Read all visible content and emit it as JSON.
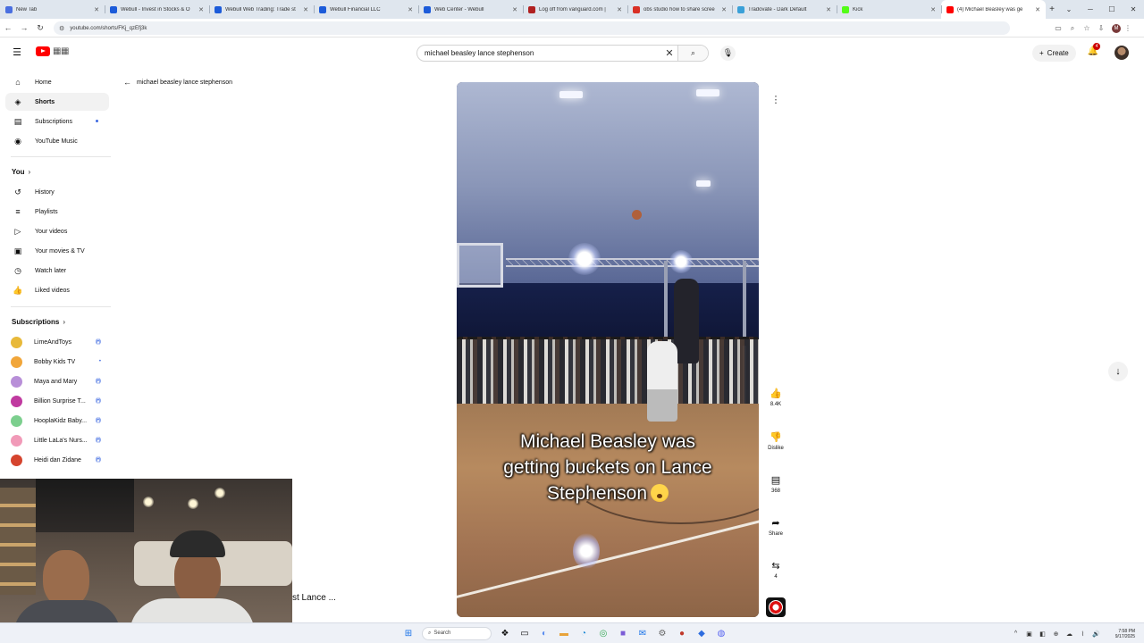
{
  "browser": {
    "tabs": [
      {
        "label": "New Tab",
        "color": "#4a6fe0"
      },
      {
        "label": "Webull - Invest in Stocks & O",
        "color": "#1c5bd9"
      },
      {
        "label": "Webull Web Trading: Trade st",
        "color": "#1c5bd9"
      },
      {
        "label": "Webull Financial LLC",
        "color": "#1c5bd9"
      },
      {
        "label": "Web Center - Webull",
        "color": "#1c5bd9"
      },
      {
        "label": "Log off from vanguard.com | ",
        "color": "#b02020"
      },
      {
        "label": "obs studio how to share scree",
        "color": "#d93025"
      },
      {
        "label": "Tradovate - Dark Default",
        "color": "#3aa0d8"
      },
      {
        "label": "Kick",
        "color": "#53fc18"
      },
      {
        "label": "(4) Michael Beasley was ge",
        "color": "#ff0000"
      }
    ],
    "url": "youtube.com/shorts/FKj_qzEfj3k"
  },
  "header": {
    "search_value": "michael beasley lance stephenson",
    "create_label": "Create",
    "notifications_badge": "4"
  },
  "sidebar": {
    "main": [
      {
        "label": "Home",
        "icon": "home-icon"
      },
      {
        "label": "Shorts",
        "icon": "shorts-icon"
      },
      {
        "label": "Subscriptions",
        "icon": "subscriptions-icon"
      },
      {
        "label": "YouTube Music",
        "icon": "music-icon"
      }
    ],
    "you_label": "You",
    "you_items": [
      {
        "label": "History",
        "icon": "history-icon"
      },
      {
        "label": "Playlists",
        "icon": "playlists-icon"
      },
      {
        "label": "Your videos",
        "icon": "your-videos-icon"
      },
      {
        "label": "Your movies & TV",
        "icon": "movies-icon"
      },
      {
        "label": "Watch later",
        "icon": "watch-later-icon"
      },
      {
        "label": "Liked videos",
        "icon": "liked-icon"
      }
    ],
    "subscriptions_label": "Subscriptions",
    "subscriptions": [
      {
        "label": "LimeAndToys",
        "color": "#e8b93a"
      },
      {
        "label": "Bobby Kids TV",
        "color": "#f1a63a"
      },
      {
        "label": "Maya and Mary",
        "color": "#b88fd8"
      },
      {
        "label": "Billion Surprise T...",
        "color": "#c03aa0"
      },
      {
        "label": "HooplaKidz Baby...",
        "color": "#7ccf8e"
      },
      {
        "label": "Little LaLa's Nurs...",
        "color": "#f19ab8"
      },
      {
        "label": "Heidi dan Zidane",
        "color": "#d5442e"
      }
    ]
  },
  "main": {
    "back_label": "michael beasley lance stephenson",
    "caption_lines": [
      "Michael Beasley was",
      "getting buckets on Lance",
      "Stephenson"
    ],
    "actions": {
      "likes": "8.4K",
      "dislike_label": "Dislike",
      "comments": "368",
      "share_label": "Share",
      "remix_count": "4"
    },
    "peek_title": "st Lance ..."
  },
  "taskbar": {
    "search_label": "Search",
    "time": "7:58 PM",
    "date": "9/17/2025"
  }
}
